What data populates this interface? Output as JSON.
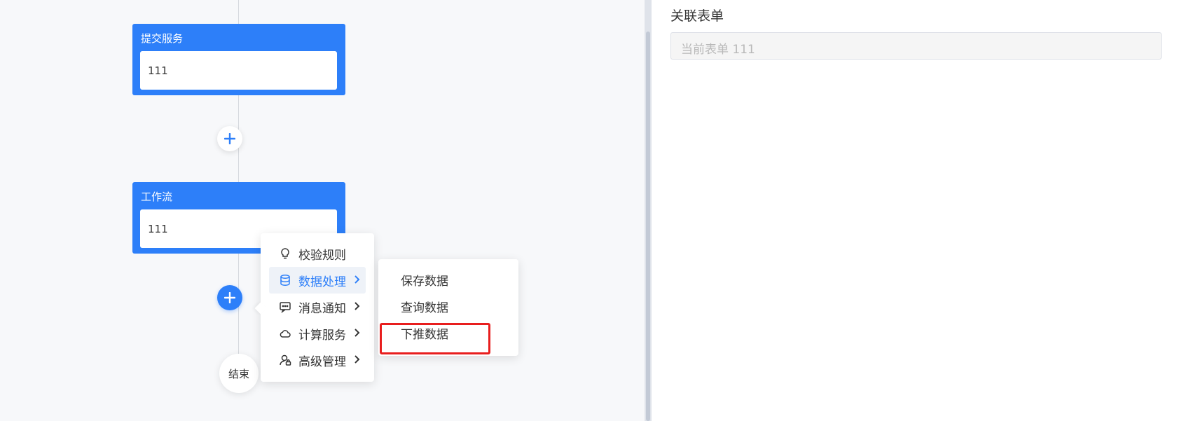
{
  "flow": {
    "nodes": [
      {
        "title": "提交服务",
        "content": "111"
      },
      {
        "title": "工作流",
        "content": "111"
      }
    ],
    "end_label": "结束"
  },
  "context_menu": {
    "items": [
      {
        "label": "校验规则",
        "icon": "bulb-icon",
        "has_submenu": false,
        "active": false
      },
      {
        "label": "数据处理",
        "icon": "database-icon",
        "has_submenu": true,
        "active": true
      },
      {
        "label": "消息通知",
        "icon": "message-icon",
        "has_submenu": true,
        "active": false
      },
      {
        "label": "计算服务",
        "icon": "cloud-icon",
        "has_submenu": true,
        "active": false
      },
      {
        "label": "高级管理",
        "icon": "user-lock-icon",
        "has_submenu": true,
        "active": false
      }
    ],
    "submenu": [
      {
        "label": "保存数据"
      },
      {
        "label": "查询数据"
      },
      {
        "label": "下推数据",
        "highlighted": true
      }
    ]
  },
  "panel": {
    "label": "关联表单",
    "input_value": "当前表单 111"
  },
  "colors": {
    "primary": "#2d7ff9",
    "highlight": "#e81e1e",
    "canvas_bg": "#f7f8fa"
  }
}
